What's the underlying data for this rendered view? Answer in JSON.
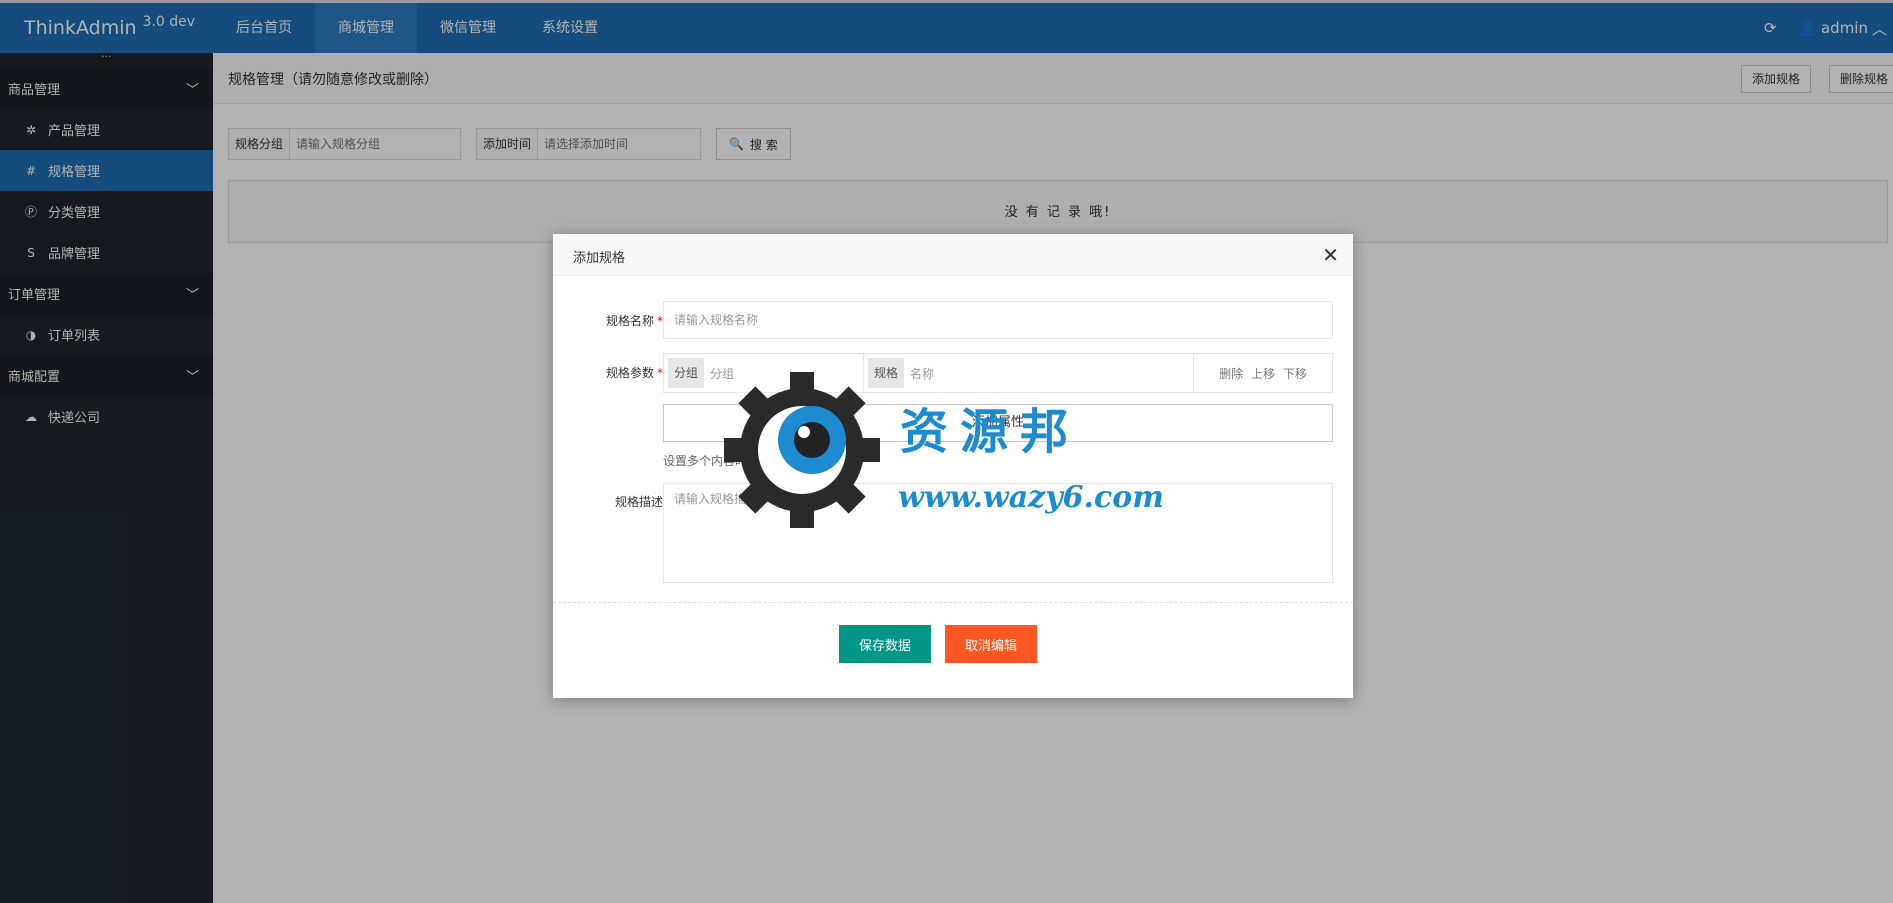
{
  "brand": {
    "name": "ThinkAdmin",
    "version": "3.0 dev"
  },
  "topnav": [
    {
      "label": "后台首页"
    },
    {
      "label": "商城管理"
    },
    {
      "label": "微信管理"
    },
    {
      "label": "系统设置"
    }
  ],
  "user": {
    "name": "admin"
  },
  "sidebar": {
    "dots": "···",
    "groups": [
      {
        "label": "商品管理",
        "items": [
          {
            "label": "产品管理",
            "icon": "gear-icon"
          },
          {
            "label": "规格管理",
            "icon": "hash-icon"
          },
          {
            "label": "分类管理",
            "icon": "circle-p-icon"
          },
          {
            "label": "品牌管理",
            "icon": "s-icon"
          }
        ]
      },
      {
        "label": "订单管理",
        "items": [
          {
            "label": "订单列表",
            "icon": "half-circle-icon"
          }
        ]
      },
      {
        "label": "商城配置",
        "items": [
          {
            "label": "快递公司",
            "icon": "cloud-icon"
          }
        ]
      }
    ]
  },
  "page": {
    "title": "规格管理（请勿随意修改或删除）",
    "add_button": "添加规格",
    "delete_button": "删除规格",
    "search": {
      "group_label": "规格分组",
      "group_placeholder": "请输入规格分组",
      "time_label": "添加时间",
      "time_placeholder": "请选择添加时间",
      "button": "搜 索"
    },
    "empty": "没 有 记 录 哦!"
  },
  "modal": {
    "title": "添加规格",
    "name_label": "规格名称",
    "name_placeholder": "请输入规格名称",
    "params_label": "规格参数",
    "group_tag": "分组",
    "group_placeholder": "分组",
    "spec_tag": "规格",
    "spec_placeholder": "名称",
    "actions": [
      "删除",
      "上移",
      "下移"
    ],
    "add_attr": "添加属性",
    "hint": "设置多个内容时请使用英文逗号隔开。",
    "desc_label": "规格描述",
    "desc_placeholder": "请输入规格描述",
    "save": "保存数据",
    "cancel": "取消编辑"
  },
  "watermark": {
    "cn": "资源邦",
    "url": "www.wazy6.com"
  },
  "colors": {
    "topbar": "#1e6eb5",
    "sidebar": "#20262d",
    "save": "#009688",
    "cancel": "#ff5722"
  }
}
